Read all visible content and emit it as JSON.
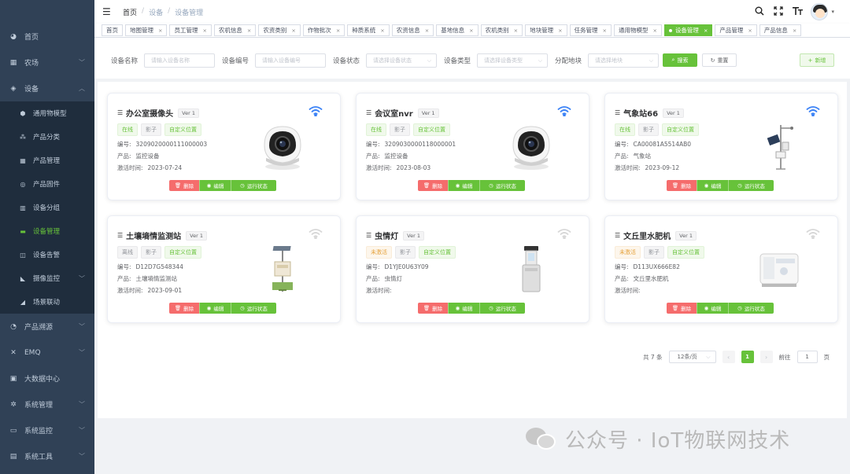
{
  "sidebar": {
    "items": [
      {
        "label": "首页",
        "icon": "dashboard-icon"
      },
      {
        "label": "农场",
        "icon": "grid-icon",
        "has_children": true
      },
      {
        "label": "设备",
        "icon": "layers-icon",
        "expanded": true
      },
      {
        "label": "产品溯源",
        "icon": "chart-icon",
        "has_children": true
      },
      {
        "label": "EMQ",
        "icon": "tools-icon",
        "has_children": true
      },
      {
        "label": "大数据中心",
        "icon": "monitor-icon"
      },
      {
        "label": "系统管理",
        "icon": "gear-icon",
        "has_children": true
      },
      {
        "label": "系统监控",
        "icon": "screen-icon",
        "has_children": true
      },
      {
        "label": "系统工具",
        "icon": "toolbox-icon",
        "has_children": true
      }
    ],
    "device_children": [
      {
        "label": "通用物模型",
        "icon": "model-icon"
      },
      {
        "label": "产品分类",
        "icon": "tree-icon"
      },
      {
        "label": "产品管理",
        "icon": "apps-icon"
      },
      {
        "label": "产品固件",
        "icon": "firmware-icon"
      },
      {
        "label": "设备分组",
        "icon": "group-icon"
      },
      {
        "label": "设备管理",
        "icon": "device-icon",
        "active": true
      },
      {
        "label": "设备告警",
        "icon": "alarm-icon"
      },
      {
        "label": "摄像监控",
        "icon": "camera-icon",
        "has_children": true
      },
      {
        "label": "场景联动",
        "icon": "scene-icon"
      }
    ]
  },
  "navbar": {
    "breadcrumb": [
      "首页",
      "设备",
      "设备管理"
    ]
  },
  "tags": [
    {
      "label": "首页",
      "closable": false
    },
    {
      "label": "地图管理",
      "closable": true
    },
    {
      "label": "员工管理",
      "closable": true
    },
    {
      "label": "农机信息",
      "closable": true
    },
    {
      "label": "农资类别",
      "closable": true
    },
    {
      "label": "作物批次",
      "closable": true
    },
    {
      "label": "种质系统",
      "closable": true
    },
    {
      "label": "农资信息",
      "closable": true
    },
    {
      "label": "基地信息",
      "closable": true
    },
    {
      "label": "农机类别",
      "closable": true
    },
    {
      "label": "地块管理",
      "closable": true
    },
    {
      "label": "任务管理",
      "closable": true
    },
    {
      "label": "通用物模型",
      "closable": true
    },
    {
      "label": "设备管理",
      "closable": true,
      "active": true
    },
    {
      "label": "产品管理",
      "closable": true
    },
    {
      "label": "产品信息",
      "closable": true
    }
  ],
  "filters": [
    {
      "label": "设备名称",
      "placeholder": "请输入设备名称",
      "select": false
    },
    {
      "label": "设备编号",
      "placeholder": "请输入设备编号",
      "select": false
    },
    {
      "label": "设备状态",
      "placeholder": "请选择设备状态",
      "select": true
    },
    {
      "label": "设备类型",
      "placeholder": "请选择设备类型",
      "select": true
    },
    {
      "label": "分配地块",
      "placeholder": "请选择地块",
      "select": true
    }
  ],
  "buttons": {
    "search": "搜索",
    "reset": "重置",
    "add": "新增"
  },
  "labels": {
    "code": "编号:",
    "product": "产品:",
    "activated": "激活时间:",
    "delete": "删除",
    "edit": "编辑",
    "run_status": "运行状态"
  },
  "devices": [
    {
      "name": "办公室摄像头",
      "version": "Ver 1",
      "status": "在线",
      "status_type": "online",
      "shadow": "影子",
      "custom": "自定义位置",
      "code": "3209020000111000003",
      "product": "监控设备",
      "activated": "2023-07-24",
      "wifi": "active",
      "image": "camera"
    },
    {
      "name": "会议室nvr",
      "version": "Ver 1",
      "status": "在线",
      "status_type": "online",
      "shadow": "影子",
      "custom": "自定义位置",
      "code": "3209030000118000001",
      "product": "监控设备",
      "activated": "2023-08-03",
      "wifi": "active",
      "image": "camera"
    },
    {
      "name": "气象站66",
      "version": "Ver 1",
      "status": "在线",
      "status_type": "online",
      "shadow": "影子",
      "custom": "自定义位置",
      "code": "CA00081A5514AB0",
      "product": "气象站",
      "activated": "2023-09-12",
      "wifi": "active",
      "image": "weather"
    },
    {
      "name": "土壤墒情监测站",
      "version": "Ver 1",
      "status": "离线",
      "status_type": "offline",
      "shadow": "影子",
      "custom": "自定义位置",
      "code": "D12D7G548344",
      "product": "土壤墒情监测站",
      "activated": "2023-09-01",
      "wifi": "inactive",
      "image": "soil"
    },
    {
      "name": "虫情灯",
      "version": "Ver 1",
      "status": "未激活",
      "status_type": "inactive",
      "shadow": "影子",
      "custom": "自定义位置",
      "code": "D1YJE0U63Y09",
      "product": "虫情灯",
      "activated": "",
      "wifi": "inactive",
      "image": "lamp"
    },
    {
      "name": "文丘里水肥机",
      "version": "Ver 1",
      "status": "未激活",
      "status_type": "inactive",
      "shadow": "影子",
      "custom": "自定义位置",
      "code": "D113UX666E82",
      "product": "文丘里水肥机",
      "activated": "",
      "wifi": "inactive",
      "image": "fertilizer"
    }
  ],
  "pagination": {
    "total_text": "共 7 条",
    "page_size": "12条/页",
    "current": "1",
    "goto_label": "前往",
    "goto_value": "1",
    "page_unit": "页"
  },
  "watermark": {
    "text": "公众号 · IoT物联网技术"
  },
  "colors": {
    "primary": "#67c23a",
    "danger": "#f56c6c",
    "warning": "#e6a23c",
    "sidebar_bg": "#304156",
    "wifi_active": "#3b82f6",
    "wifi_inactive": "#d8d8d8"
  }
}
